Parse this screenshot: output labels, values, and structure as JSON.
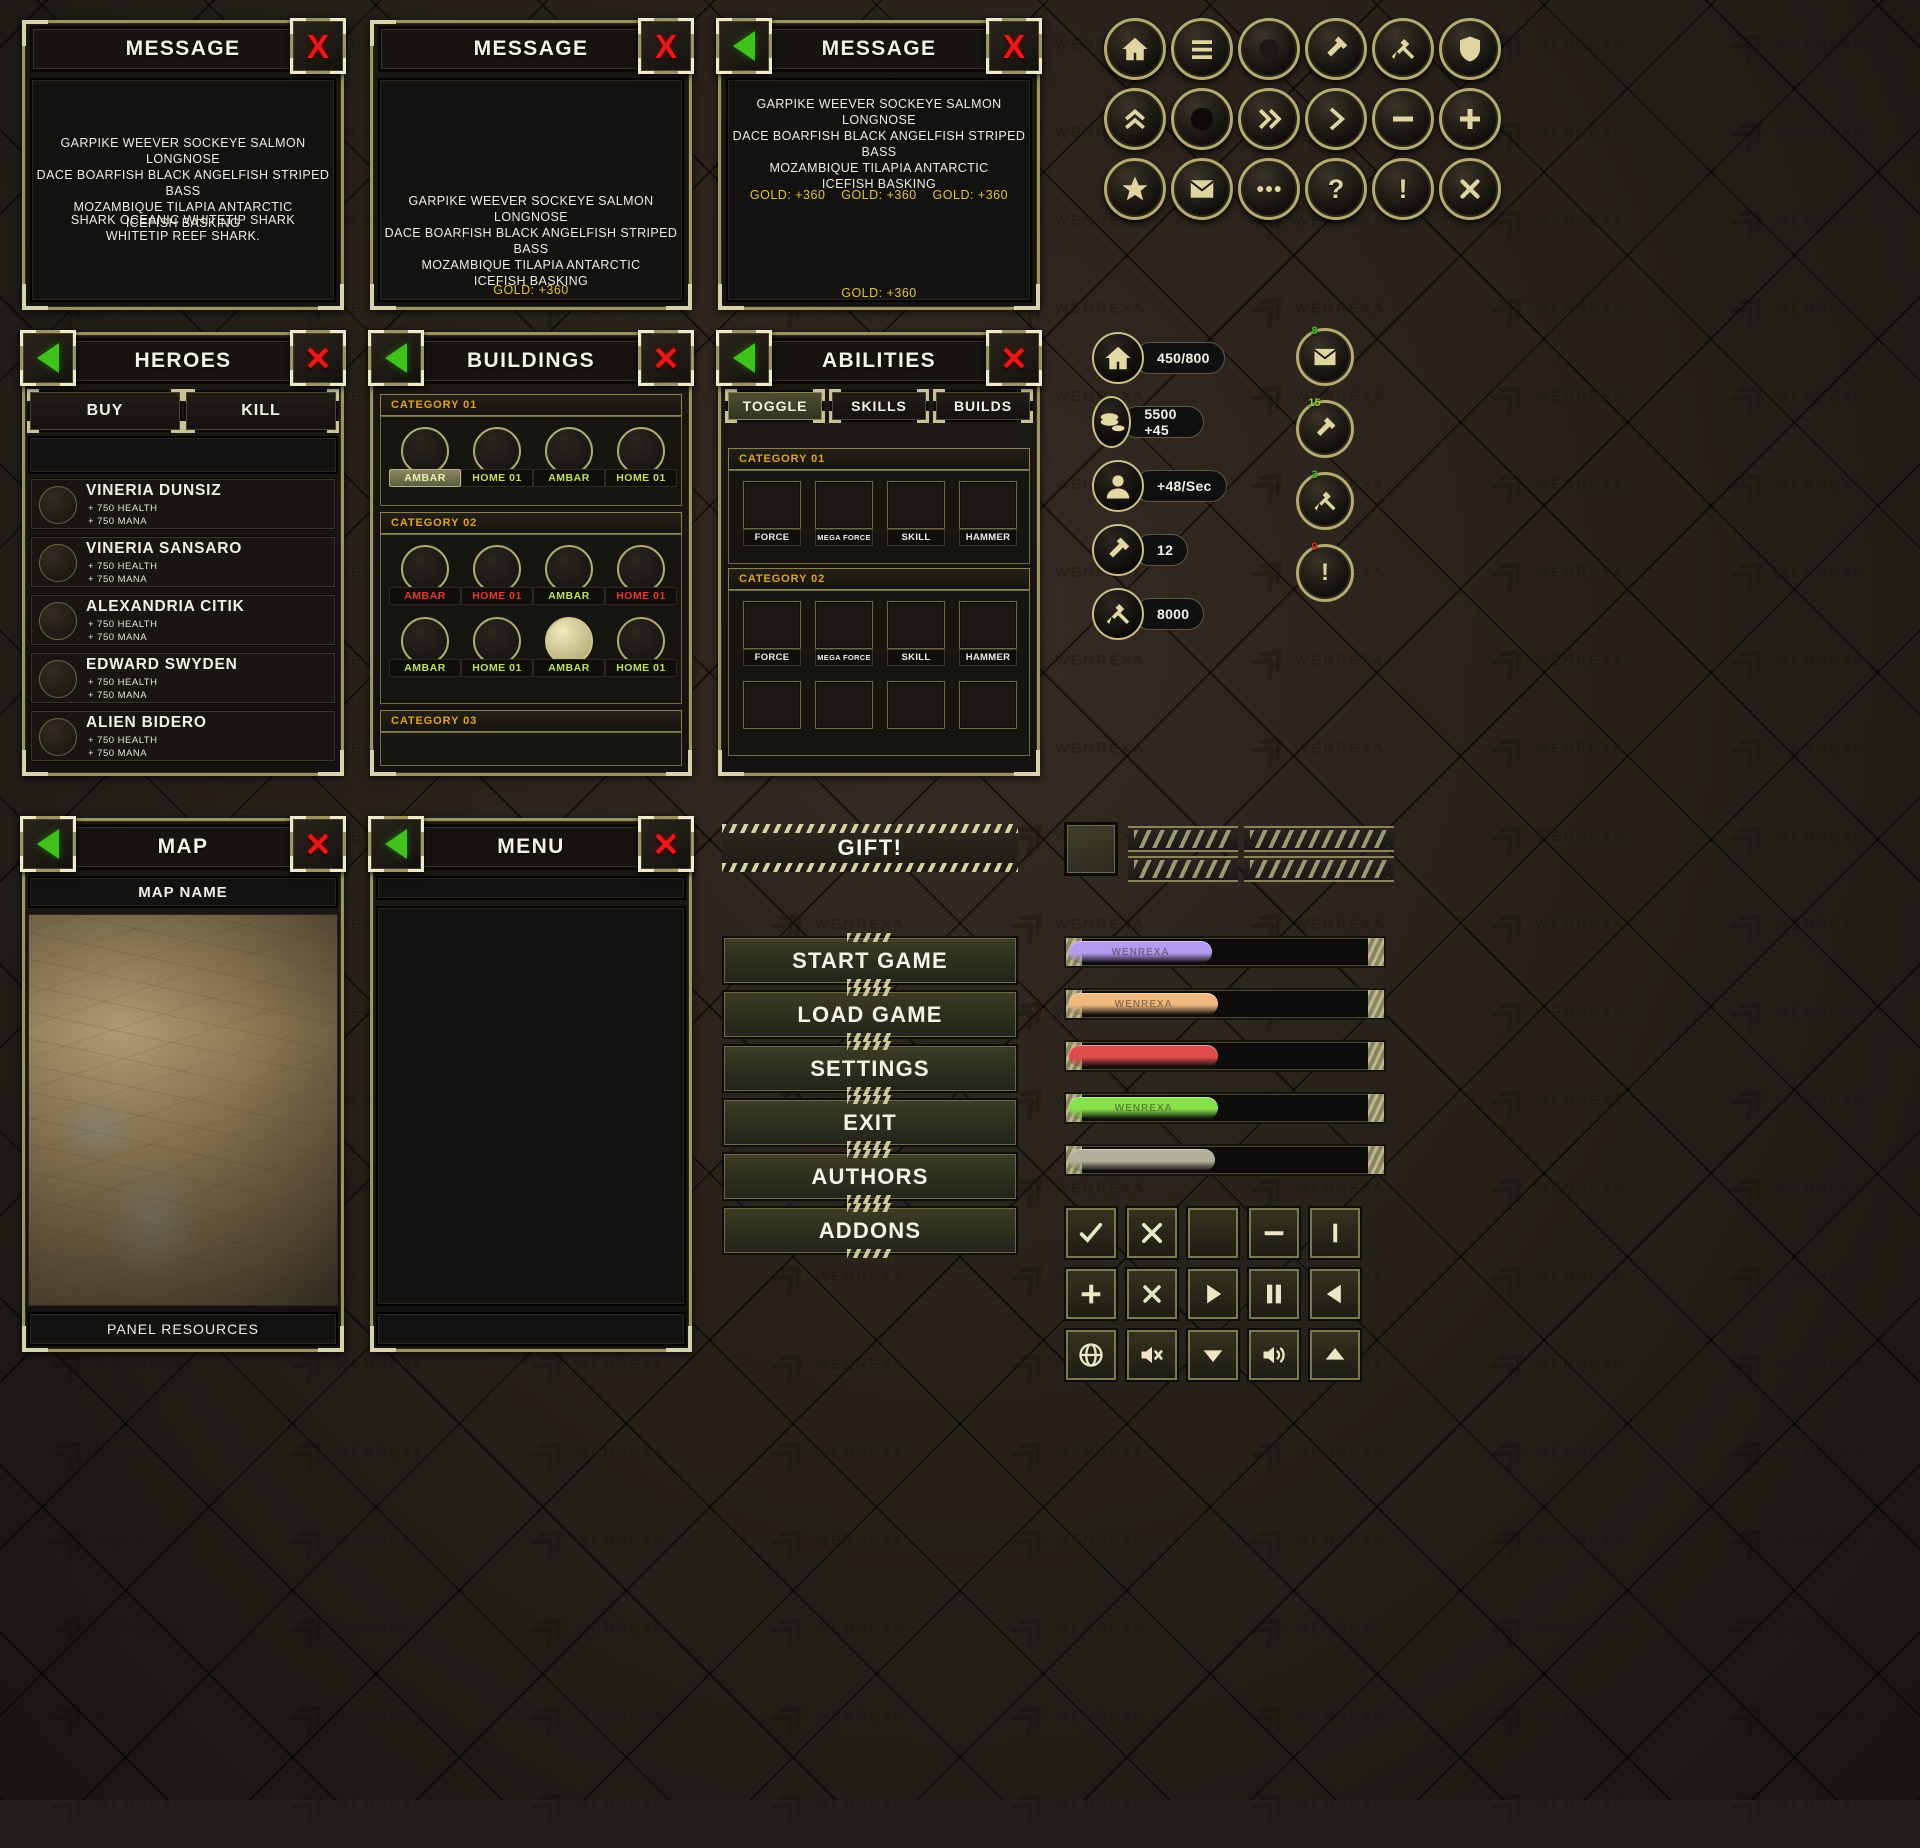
{
  "watermark": "WENREXA",
  "messages": [
    {
      "title": "MESSAGE",
      "body_1": "GARPIKE WEEVER SOCKEYE SALMON LONGNOSE\nDACE BOARFISH BLACK ANGELFISH STRIPED BASS\nMOZAMBIQUE TILAPIA ANTARCTIC\nICEFISH BASKING",
      "body_2": "SHARK OCEANIC WHITETIP SHARK\nWHITETIP REEF SHARK.",
      "close_label": "X"
    },
    {
      "title": "MESSAGE",
      "body_1": "GARPIKE WEEVER SOCKEYE SALMON LONGNOSE\nDACE BOARFISH BLACK ANGELFISH STRIPED BASS\nMOZAMBIQUE TILAPIA ANTARCTIC\nICEFISH BASKING",
      "gold_1": "GOLD: +360",
      "close_label": "X"
    },
    {
      "title": "MESSAGE",
      "body_1": "GARPIKE WEEVER SOCKEYE SALMON LONGNOSE\nDACE BOARFISH BLACK ANGELFISH STRIPED BASS\nMOZAMBIQUE TILAPIA ANTARCTIC\nICEFISH BASKING",
      "golds": [
        "GOLD: +360",
        "GOLD: +360",
        "GOLD: +360"
      ],
      "gold_bottom": "GOLD: +360",
      "close_label": "X"
    }
  ],
  "heroes_panel": {
    "title": "HEROES",
    "tabs": [
      {
        "label": "BUY"
      },
      {
        "label": "KILL"
      }
    ],
    "rows": [
      {
        "name": "VINERIA DUNSIZ",
        "stat1": "+ 750 HEALTH",
        "stat2": "+ 750 MANA"
      },
      {
        "name": "VINERIA SANSARO",
        "stat1": "+ 750 HEALTH",
        "stat2": "+ 750 MANA"
      },
      {
        "name": "ALEXANDRIA CITIK",
        "stat1": "+ 750 HEALTH",
        "stat2": "+ 750 MANA"
      },
      {
        "name": "EDWARD SWYDEN",
        "stat1": "+ 750 HEALTH",
        "stat2": "+ 750 MANA"
      },
      {
        "name": "ALIEN BIDERO",
        "stat1": "+ 750 HEALTH",
        "stat2": "+ 750 MANA"
      }
    ]
  },
  "buildings_panel": {
    "title": "BUILDINGS",
    "categories": [
      {
        "label": "CATEGORY 01",
        "rows": [
          [
            {
              "label": "AMBAR",
              "state": "selected"
            },
            {
              "label": "HOME 01",
              "state": "normal"
            },
            {
              "label": "AMBAR",
              "state": "normal"
            },
            {
              "label": "HOME 01",
              "state": "normal"
            }
          ]
        ]
      },
      {
        "label": "CATEGORY 02",
        "rows": [
          [
            {
              "label": "AMBAR",
              "state": "red"
            },
            {
              "label": "HOME 01",
              "state": "red"
            },
            {
              "label": "AMBAR",
              "state": "normal"
            },
            {
              "label": "HOME 01",
              "state": "red"
            }
          ],
          [
            {
              "label": "AMBAR",
              "state": "normal"
            },
            {
              "label": "HOME 01",
              "state": "normal"
            },
            {
              "label": "AMBAR",
              "state": "normal",
              "filled": true
            },
            {
              "label": "HOME 01",
              "state": "normal"
            }
          ]
        ]
      },
      {
        "label": "CATEGORY 03",
        "rows": []
      }
    ]
  },
  "abilities_panel": {
    "title": "ABILITIES",
    "tabs": [
      {
        "label": "TOGGLE",
        "selected": true
      },
      {
        "label": "SKILLS"
      },
      {
        "label": "BUILDS"
      }
    ],
    "categories": [
      {
        "label": "CATEGORY 01",
        "slots": [
          "FORCE",
          "MEGA FORCE",
          "SKILL",
          "HAMMER"
        ]
      },
      {
        "label": "CATEGORY 02",
        "slots": [
          "FORCE",
          "MEGA FORCE",
          "SKILL",
          "HAMMER"
        ],
        "empty_row": true
      }
    ]
  },
  "map_panel": {
    "title": "MAP",
    "map_name": "MAP NAME",
    "footer": "PANEL RESOURCES"
  },
  "menu_panel": {
    "title": "MENU"
  },
  "gift": {
    "label": "GIFT!"
  },
  "main_menu": {
    "items": [
      {
        "label": "START GAME"
      },
      {
        "label": "LOAD GAME"
      },
      {
        "label": "SETTINGS"
      },
      {
        "label": "EXIT"
      },
      {
        "label": "AUTHORS"
      },
      {
        "label": "ADDONS"
      }
    ]
  },
  "round_buttons": [
    [
      {
        "icon": "home-icon"
      },
      {
        "icon": "menu-icon"
      },
      {
        "icon": "circle-icon"
      },
      {
        "icon": "hammer-icon"
      },
      {
        "icon": "tools-icon"
      },
      {
        "icon": "shield-icon"
      }
    ],
    [
      {
        "icon": "double-chevron-up-icon"
      },
      {
        "icon": "filled-circle-icon"
      },
      {
        "icon": "double-chevron-right-icon"
      },
      {
        "icon": "chevron-right-icon"
      },
      {
        "icon": "minus-icon"
      },
      {
        "icon": "plus-icon"
      }
    ],
    [
      {
        "icon": "star-icon"
      },
      {
        "icon": "envelope-icon"
      },
      {
        "icon": "ellipsis-icon"
      },
      {
        "icon": "question-icon"
      },
      {
        "icon": "exclamation-icon"
      },
      {
        "icon": "close-x-icon"
      }
    ]
  ],
  "resources": [
    {
      "icon": "home-icon",
      "value": "450/800"
    },
    {
      "icon": "coins-icon",
      "value": "5500 +45"
    },
    {
      "icon": "person-icon",
      "value": "+48/Sec"
    },
    {
      "icon": "hammer-icon",
      "value": "12"
    },
    {
      "icon": "tools-icon",
      "value": "8000"
    }
  ],
  "notifications": [
    {
      "icon": "envelope-icon",
      "count": "8",
      "color": "#3fc21c"
    },
    {
      "icon": "hammer-icon",
      "count": "15",
      "color": "#8ddc2a"
    },
    {
      "icon": "tools-icon",
      "count": "3",
      "color": "#3fc21c"
    },
    {
      "icon": "exclamation-icon",
      "count": "9",
      "color": "#e02a1c"
    }
  ],
  "progress_bars": [
    {
      "color": "#b49bf0",
      "percent": 45,
      "label": "WENREXA"
    },
    {
      "color": "#f0b87e",
      "percent": 47,
      "label": "WENREXA"
    },
    {
      "color": "#e04c4c",
      "percent": 47,
      "label": ""
    },
    {
      "color": "#86e04a",
      "percent": 47,
      "label": "WENREXA"
    },
    {
      "color": "#b2b09a",
      "percent": 46,
      "label": ""
    }
  ],
  "glyph_buttons": [
    [
      {
        "icon": "check-icon"
      },
      {
        "icon": "close-x-icon"
      },
      {
        "icon": "blank-icon"
      },
      {
        "icon": "minus-icon"
      },
      {
        "icon": "exclamation-bar-icon"
      }
    ],
    [
      {
        "icon": "plus-icon"
      },
      {
        "icon": "cross-x-icon"
      },
      {
        "icon": "play-icon"
      },
      {
        "icon": "pause-icon"
      },
      {
        "icon": "arrow-left-icon"
      }
    ],
    [
      {
        "icon": "globe-icon"
      },
      {
        "icon": "volume-mute-icon"
      },
      {
        "icon": "arrow-down-icon"
      },
      {
        "icon": "volume-on-icon"
      },
      {
        "icon": "arrow-up-icon"
      }
    ]
  ]
}
